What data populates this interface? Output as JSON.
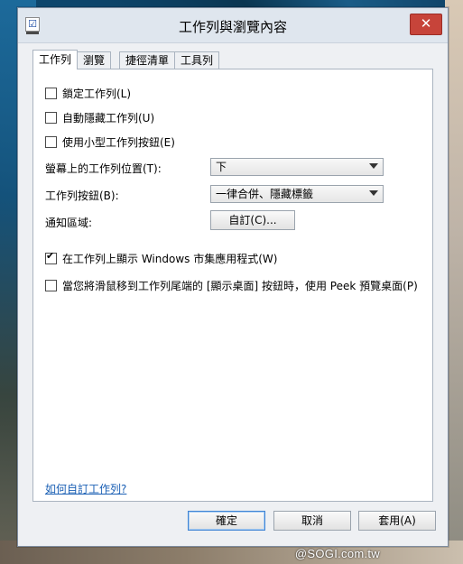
{
  "window": {
    "title": "工作列與瀏覽內容",
    "close_glyph": "✕"
  },
  "tabs": [
    {
      "label": "工作列",
      "active": true
    },
    {
      "label": "瀏覽",
      "active": false
    },
    {
      "label": "捷徑清單",
      "active": false
    },
    {
      "label": "工具列",
      "active": false
    }
  ],
  "options": {
    "lock_taskbar": {
      "label": "鎖定工作列(L)",
      "checked": false
    },
    "auto_hide": {
      "label": "自動隱藏工作列(U)",
      "checked": false
    },
    "small_buttons": {
      "label": "使用小型工作列按鈕(E)",
      "checked": false
    },
    "position": {
      "label": "螢幕上的工作列位置(T):",
      "value": "下"
    },
    "buttons": {
      "label": "工作列按鈕(B):",
      "value": "一律合併、隱藏標籤"
    },
    "notification": {
      "label": "通知區域:",
      "button": "自訂(C)..."
    },
    "show_store_apps": {
      "label": "在工作列上顯示 Windows 市集應用程式(W)",
      "checked": true
    },
    "peek": {
      "label": "當您將滑鼠移到工作列尾端的 [顯示桌面] 按鈕時，使用 Peek 預覽桌面(P)",
      "checked": false
    }
  },
  "help_link": "如何自訂工作列?",
  "footer": {
    "ok": "確定",
    "cancel": "取消",
    "apply": "套用(A)"
  },
  "watermark": "@SOGI.com.tw",
  "colors": {
    "close_button": "#c7443a",
    "link": "#1a5fb4",
    "default_button_border": "#3f84d4"
  }
}
